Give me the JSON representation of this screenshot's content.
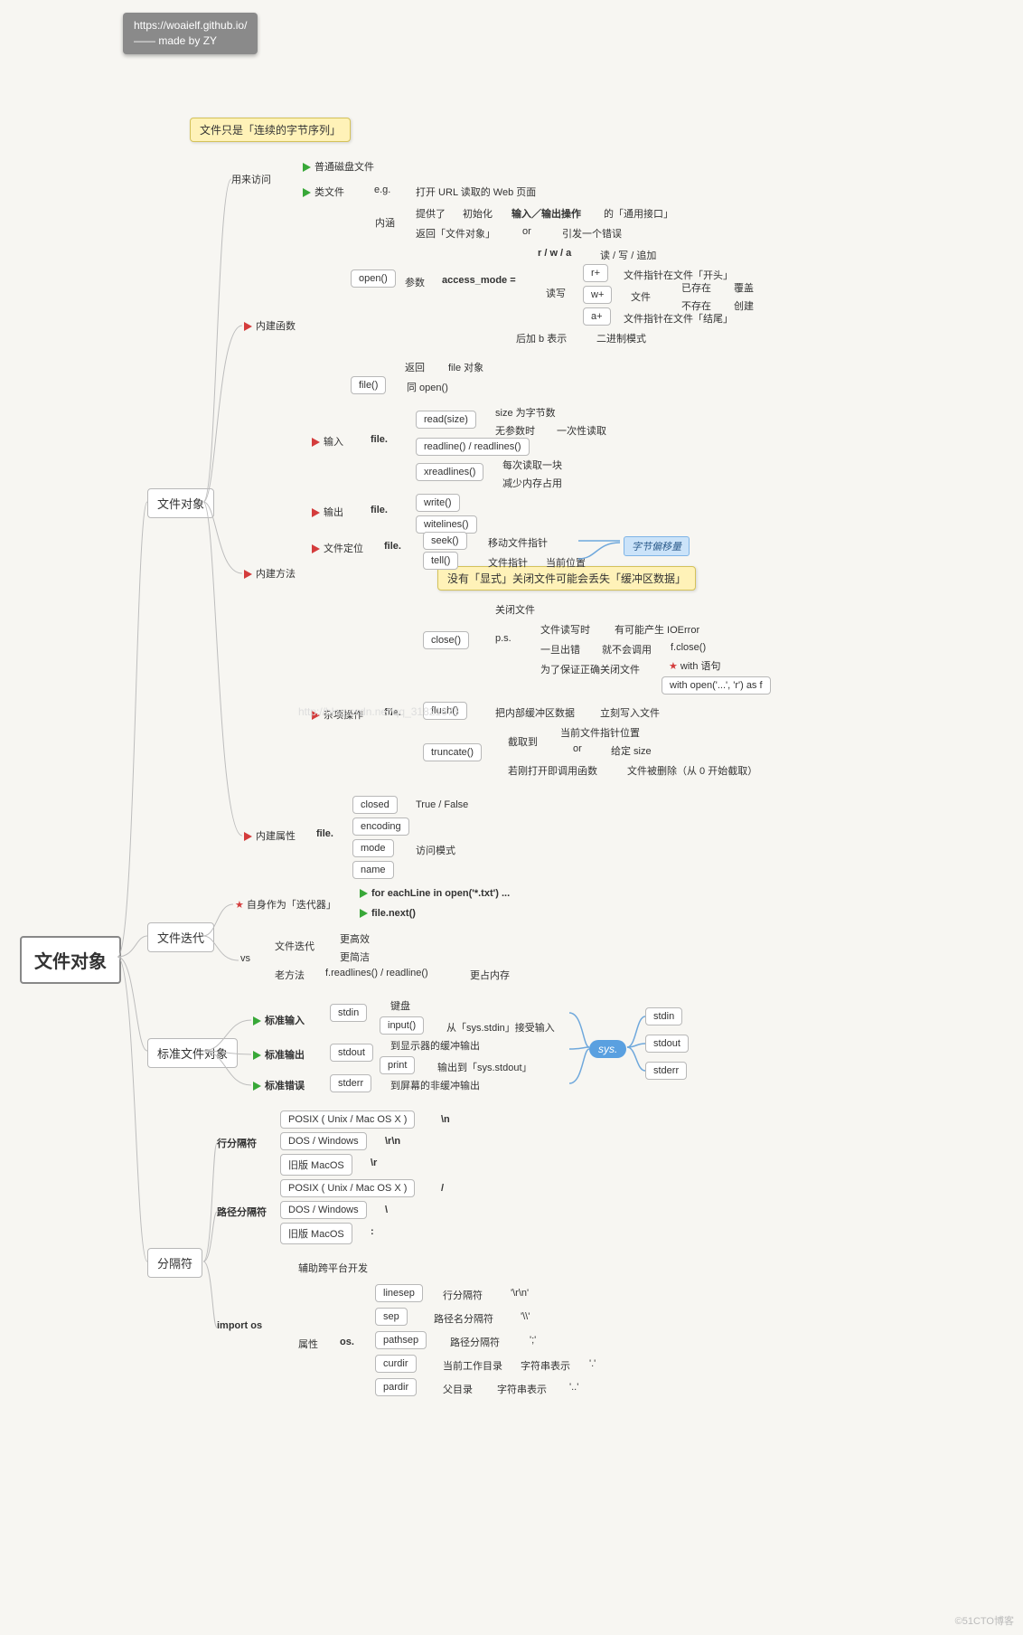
{
  "header": {
    "url": "https://woaielf.github.io/",
    "credit": "—— made by ZY"
  },
  "root": "文件对象",
  "notes": {
    "n1": "文件只是「连续的字节序列」",
    "n2": "没有「显式」关闭文件可能会丢失「缓冲区数据」"
  },
  "labels": {
    "byteoff": "字节偏移量",
    "sys": "sys."
  },
  "s1": {
    "title": "文件对象",
    "a": {
      "title": "用来访问",
      "i1": "普通磁盘文件",
      "i2": "类文件",
      "eg": "e.g.",
      "egv": "打开 URL 读取的 Web 页面"
    },
    "b": {
      "title": "内建函数",
      "open": {
        "name": "open()",
        "neihan": "内涵",
        "nh1": "提供了",
        "nh2": "初始化",
        "nh3": "输入／输出操作",
        "nh4": "的「通用接口」",
        "nh5": "返回「文件对象」",
        "nh_or": "or",
        "nh6": "引发一个错误",
        "param": "参数",
        "pm": "access_mode =",
        "rwa": "r / w / a",
        "rwa2": "读 / 写 / 追加",
        "rw": "读写",
        "rp": "r+",
        "rp2": "文件指针在文件「开头」",
        "wp": "w+",
        "wp2": "文件",
        "ex": "已存在",
        "ex2": "覆盖",
        "nex": "不存在",
        "nex2": "创建",
        "ap": "a+",
        "ap2": "文件指针在文件「结尾」",
        "bmode": "后加 b 表示",
        "bmode2": "二进制模式",
        "ret": "返回",
        "ret2": "file 对象"
      },
      "file": {
        "name": "file()",
        "d": "同 open()"
      }
    },
    "c": {
      "title": "内建方法",
      "in": {
        "title": "输入",
        "pre": "file.",
        "read": "read(size)",
        "rd1": "size 为字节数",
        "rd2": "无参数时",
        "rd3": "一次性读取",
        "rl": "readline() / readlines()",
        "xr": "xreadlines()",
        "xr1": "每次读取一块",
        "xr2": "减少内存占用"
      },
      "out": {
        "title": "输出",
        "pre": "file.",
        "w": "write()",
        "wl": "witelines()"
      },
      "seek": {
        "title": "文件定位",
        "pre": "file.",
        "sk": "seek()",
        "sk1": "移动文件指针",
        "tl": "tell()",
        "tl1": "文件指针",
        "tl2": "当前位置"
      },
      "misc": {
        "title": "杂项操作",
        "pre": "file.",
        "close": "close()",
        "cl1": "关闭文件",
        "cl2": "p.s.",
        "cl3": "文件读写时",
        "cl4": "有可能产生 IOError",
        "cl5": "一旦出错",
        "cl6": "就不会调用",
        "cl7": "f.close()",
        "cl8": "为了保证正确关闭文件",
        "cl9": "with 语句",
        "cl10": "with open('...', 'r') as f",
        "flush": "flush()",
        "fl1": "把内部缓冲区数据",
        "fl2": "立刻写入文件",
        "trunc": "truncate()",
        "tr1": "截取到",
        "tr2": "当前文件指针位置",
        "tr3": "or",
        "tr4": "给定 size",
        "tr5": "若刚打开即调用函数",
        "tr6": "文件被删除（从 0 开始截取）"
      }
    },
    "d": {
      "title": "内建属性",
      "pre": "file.",
      "closed": "closed",
      "cv": "True / False",
      "enc": "encoding",
      "mode": "mode",
      "mv": "访问模式",
      "name": "name"
    }
  },
  "s2": {
    "title": "文件迭代",
    "self": {
      "title": "自身作为「迭代器」",
      "l1": "for eachLine in open('*.txt') ...",
      "l2": "file.next()"
    },
    "vs": {
      "title": "vs",
      "a": "文件迭代",
      "a1": "更高效",
      "a2": "更简洁",
      "b": "老方法",
      "b1": "f.readlines() / readline()",
      "b2": "更占内存"
    }
  },
  "s3": {
    "title": "标准文件对象",
    "stdin": {
      "t": "标准输入",
      "n": "stdin",
      "k": "键盘",
      "inp": "input()",
      "d": "从「sys.stdin」接受输入"
    },
    "stdout": {
      "t": "标准输出",
      "n": "stdout",
      "d1": "到显示器的缓冲输出",
      "p": "print",
      "d2": "输出到「sys.stdout」"
    },
    "stderr": {
      "t": "标准错误",
      "n": "stderr",
      "d": "到屏幕的非缓冲输出"
    },
    "sys": {
      "a": "stdin",
      "b": "stdout",
      "c": "stderr"
    }
  },
  "s4": {
    "title": "分隔符",
    "line": {
      "t": "行分隔符",
      "a": "POSIX ( Unix / Mac OS X )",
      "av": "\\n",
      "b": "DOS / Windows",
      "bv": "\\r\\n",
      "c": "旧版 MacOS",
      "cv": "\\r"
    },
    "path": {
      "t": "路径分隔符",
      "a": "POSIX ( Unix / Mac OS X )",
      "av": "/",
      "b": "DOS / Windows",
      "bv": "\\",
      "c": "旧版 MacOS",
      "cv": ":"
    },
    "os": {
      "t": "import os",
      "h": "辅助跨平台开发",
      "attr": "属性",
      "pre": "os.",
      "ls": "linesep",
      "ls1": "行分隔符",
      "ls2": "'\\r\\n'",
      "sep": "sep",
      "sep1": "路径名分隔符",
      "sep2": "'\\\\'",
      "ps": "pathsep",
      "ps1": "路径分隔符",
      "ps2": "';'",
      "cd": "curdir",
      "cd1": "当前工作目录",
      "cd2": "字符串表示",
      "cd3": "'.'",
      "pd": "pardir",
      "pd1": "父目录",
      "pd2": "字符串表示",
      "pd3": "'..'"
    }
  },
  "wm": "©51CTO博客",
  "wm2": "http://blog.csdn.net/qq_31821675"
}
